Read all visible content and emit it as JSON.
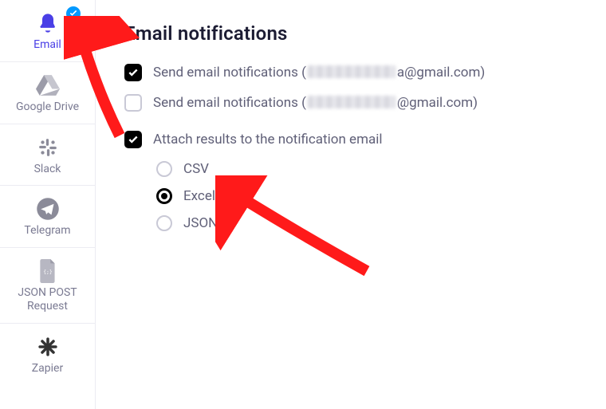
{
  "sidebar": {
    "items": [
      {
        "label": "Email",
        "icon": "bell-icon",
        "active": true,
        "badge": true
      },
      {
        "label": "Google Drive",
        "icon": "google-drive-icon"
      },
      {
        "label": "Slack",
        "icon": "slack-icon"
      },
      {
        "label": "Telegram",
        "icon": "telegram-icon"
      },
      {
        "label": "JSON POST Request",
        "icon": "json-post-icon"
      },
      {
        "label": "Zapier",
        "icon": "zapier-icon"
      }
    ]
  },
  "main": {
    "title": "Email notifications",
    "notify1_prefix": "Send email notifications (",
    "notify1_suffix": "a@gmail.com)",
    "notify1_checked": true,
    "notify2_prefix": "Send email notifications (",
    "notify2_suffix": "@gmail.com)",
    "notify2_checked": false,
    "attach_label": "Attach results to the notification email",
    "attach_checked": true,
    "formats": {
      "csv": {
        "label": "CSV",
        "selected": false
      },
      "excel": {
        "label": "Excel",
        "selected": true
      },
      "json": {
        "label": "JSON",
        "selected": false
      }
    }
  }
}
